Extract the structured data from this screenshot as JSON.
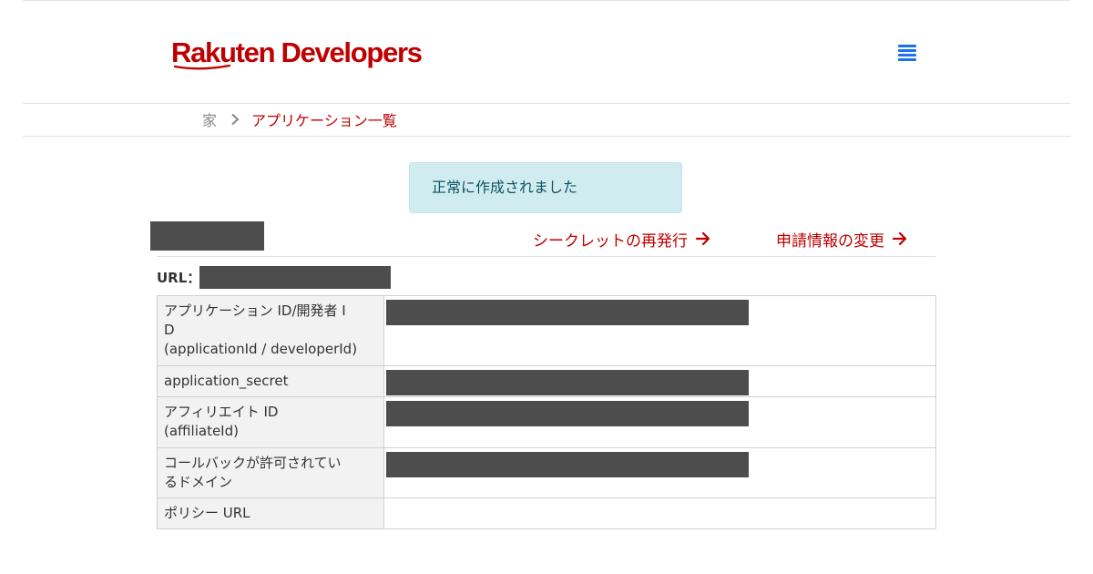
{
  "header": {
    "logo_text": "Rakuten Developers",
    "menu_icon": "hamburger-menu-icon",
    "brand_color": "#bf0000",
    "menu_color": "#1a73e8"
  },
  "breadcrumb": {
    "home": "家",
    "separator_icon": "chevron-right-icon",
    "current": "アプリケーション一覧"
  },
  "alert": {
    "message": "正常に作成されました",
    "background": "#d1ecf1"
  },
  "actions": {
    "reissue_secret": "シークレットの再発行",
    "edit_application": "申請情報の変更",
    "arrow_icon": "arrow-right-icon"
  },
  "url": {
    "label": "URL："
  },
  "credentials": {
    "rows": [
      {
        "label_lines": [
          "アプリケーション ID/開発者 I",
          "D",
          "(applicationId / developerId)"
        ],
        "value_redacted": true
      },
      {
        "label_lines": [
          "application_secret"
        ],
        "value_redacted": true
      },
      {
        "label_lines": [
          "アフィリエイト ID",
          "(affiliateId)"
        ],
        "value_redacted": true
      },
      {
        "label_lines": [
          "コールバックが許可されてい",
          "るドメイン"
        ],
        "value_redacted": true
      },
      {
        "label_lines": [
          "ポリシー URL"
        ],
        "value_redacted": false
      }
    ]
  }
}
